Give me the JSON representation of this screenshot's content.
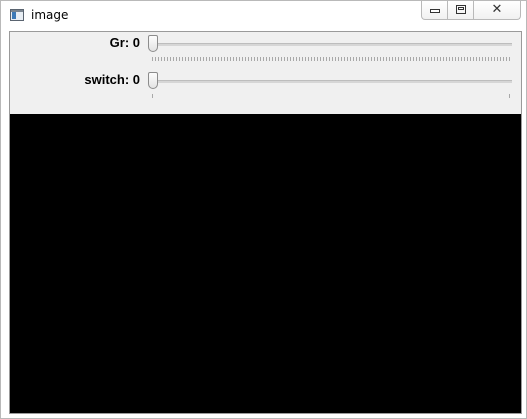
{
  "window": {
    "title": "image",
    "icon": "opencv-window-icon",
    "buttons": {
      "minimize_icon": "minimize-icon",
      "maximize_icon": "maximize-icon",
      "close_label": "✕"
    }
  },
  "trackbars": [
    {
      "label": "Gr: 0",
      "value": 0,
      "max_tick": "dense"
    },
    {
      "label": "switch: 0",
      "value": 0,
      "max_tick": "sparse"
    }
  ],
  "image": {
    "fill": "#000000"
  },
  "colors": {
    "panel": "#f0f0f0",
    "image": "#000000"
  }
}
